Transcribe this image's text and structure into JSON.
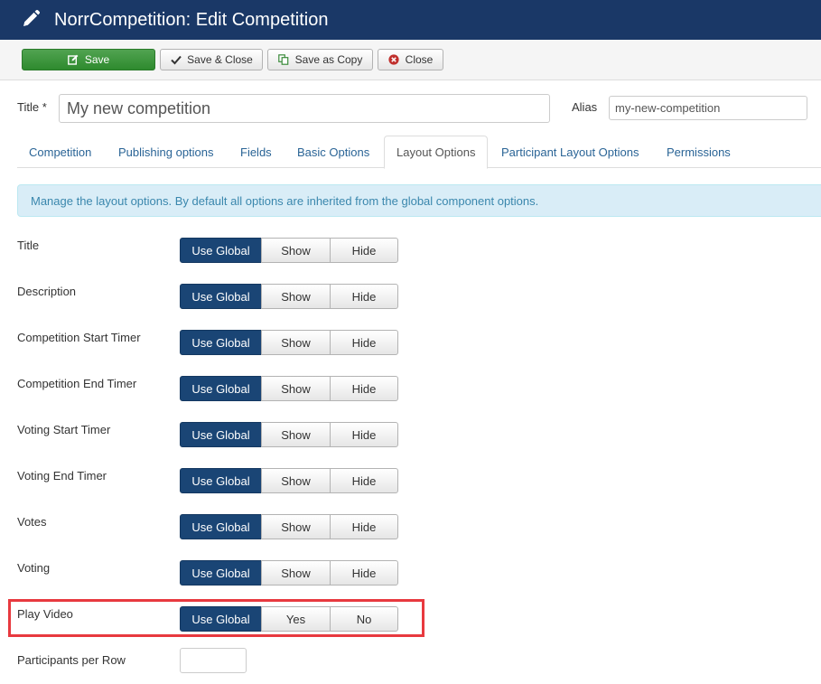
{
  "header": {
    "title": "NorrCompetition: Edit Competition",
    "icon": "pencil-icon",
    "background": "#1a3867"
  },
  "toolbar": {
    "save_label": "Save",
    "save_close_label": "Save & Close",
    "save_copy_label": "Save as Copy",
    "close_label": "Close"
  },
  "form": {
    "title_label": "Title *",
    "title_value": "My new competition",
    "alias_label": "Alias",
    "alias_value": "my-new-competition"
  },
  "tabs": [
    {
      "label": "Competition",
      "active": false
    },
    {
      "label": "Publishing options",
      "active": false
    },
    {
      "label": "Fields",
      "active": false
    },
    {
      "label": "Basic Options",
      "active": false
    },
    {
      "label": "Layout Options",
      "active": true
    },
    {
      "label": "Participant Layout Options",
      "active": false
    },
    {
      "label": "Permissions",
      "active": false
    }
  ],
  "alert": {
    "text": "Manage the layout options. By default all options are inherited from the global component options."
  },
  "options": [
    {
      "label": "Title",
      "choices": [
        "Use Global",
        "Show",
        "Hide"
      ],
      "selected": "Use Global"
    },
    {
      "label": "Description",
      "choices": [
        "Use Global",
        "Show",
        "Hide"
      ],
      "selected": "Use Global"
    },
    {
      "label": "Competition Start Timer",
      "choices": [
        "Use Global",
        "Show",
        "Hide"
      ],
      "selected": "Use Global"
    },
    {
      "label": "Competition End Timer",
      "choices": [
        "Use Global",
        "Show",
        "Hide"
      ],
      "selected": "Use Global"
    },
    {
      "label": "Voting Start Timer",
      "choices": [
        "Use Global",
        "Show",
        "Hide"
      ],
      "selected": "Use Global"
    },
    {
      "label": "Voting End Timer",
      "choices": [
        "Use Global",
        "Show",
        "Hide"
      ],
      "selected": "Use Global"
    },
    {
      "label": "Votes",
      "choices": [
        "Use Global",
        "Show",
        "Hide"
      ],
      "selected": "Use Global"
    },
    {
      "label": "Voting",
      "choices": [
        "Use Global",
        "Show",
        "Hide"
      ],
      "selected": "Use Global"
    },
    {
      "label": "Play Video",
      "choices": [
        "Use Global",
        "Yes",
        "No"
      ],
      "selected": "Use Global"
    }
  ],
  "participants_per_row": {
    "label": "Participants per Row",
    "value": ""
  },
  "colors": {
    "accent": "#1a4575",
    "save_green": "#2e8a2e",
    "highlight_red": "#e8393f",
    "link": "#2a6496"
  }
}
